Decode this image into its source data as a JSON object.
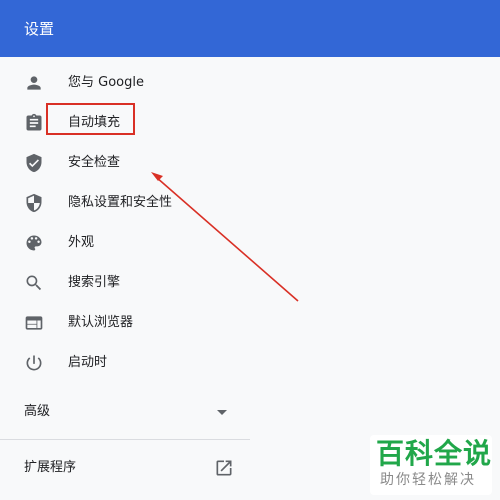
{
  "header": {
    "title": "设置"
  },
  "sidebar": {
    "items": [
      {
        "label": "您与 Google",
        "icon": "person-icon"
      },
      {
        "label": "自动填充",
        "icon": "clipboard-icon"
      },
      {
        "label": "安全检查",
        "icon": "shield-check-icon"
      },
      {
        "label": "隐私设置和安全性",
        "icon": "shield-half-icon"
      },
      {
        "label": "外观",
        "icon": "palette-icon"
      },
      {
        "label": "搜索引擎",
        "icon": "search-icon"
      },
      {
        "label": "默认浏览器",
        "icon": "browser-window-icon"
      },
      {
        "label": "启动时",
        "icon": "power-icon"
      }
    ],
    "advanced_label": "高级",
    "extensions_label": "扩展程序"
  },
  "watermark": {
    "title": "百科全说",
    "subtitle": "助你轻松解决"
  },
  "colors": {
    "header": "#3367d6",
    "annotation": "#d93025",
    "watermark_green": "#21a74a",
    "icon": "#5f6368"
  }
}
